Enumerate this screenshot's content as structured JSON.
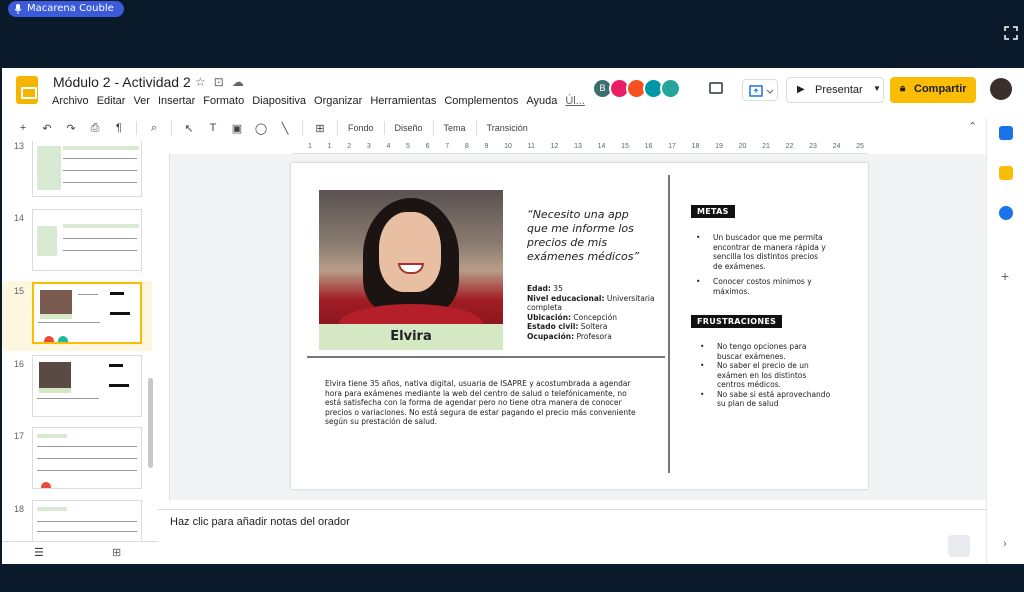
{
  "meet": {
    "user": "Macarena Couble"
  },
  "doc": {
    "title": "Módulo 2 - Actividad 2",
    "menu": [
      "Archivo",
      "Editar",
      "Ver",
      "Insertar",
      "Formato",
      "Diapositiva",
      "Organizar",
      "Herramientas",
      "Complementos",
      "Ayuda",
      "Úl..."
    ],
    "present_label": "Presentar",
    "share_label": "Compartir",
    "avatar_b": "B",
    "avatar_colors": [
      "#3c6e71",
      "#e91e63",
      "#f4511e",
      "#0097a7",
      "#26a69a"
    ]
  },
  "toolbar": {
    "fondo": "Fondo",
    "diseno": "Diseño",
    "tema": "Tema",
    "transicion": "Transición"
  },
  "ruler": [
    "1",
    "1",
    "2",
    "3",
    "4",
    "5",
    "6",
    "7",
    "8",
    "9",
    "10",
    "11",
    "12",
    "13",
    "14",
    "15",
    "16",
    "17",
    "18",
    "19",
    "20",
    "21",
    "22",
    "23",
    "24",
    "25"
  ],
  "slides": {
    "numbers": [
      "13",
      "14",
      "15",
      "16",
      "17",
      "18"
    ]
  },
  "persona": {
    "name": "Elvira",
    "quote": "“Necesito una app que me informe los precios de mis exámenes médicos”",
    "edad_label": "Edad:",
    "edad": " 35",
    "nivel_label": "Nivel educacional:",
    "nivel": " Universitaria completa",
    "ubicacion_label": "Ubicación:",
    "ubicacion": " Concepción",
    "civil_label": "Estado civil:",
    "civil": "  Soltera",
    "ocupacion_label": "Ocupación:",
    "ocupacion": " Profesora",
    "description": "Elvira tiene 35 años, nativa digital, usuaria de ISAPRE y acostumbrada a agendar hora para exámenes mediante la web del centro de salud o telefónicamente, no está satisfecha con la forma de agendar pero no tiene otra manera de conocer precios o variaciones. No está segura de estar pagando el precio más conveniente según su prestación de salud.",
    "metas_title": "METAS",
    "metas": [
      "Un buscador que me permita encontrar de manera rápida y sencilla los distintos precios de exámenes.",
      "Conocer costos mínimos y máximos."
    ],
    "frus_title": "FRUSTRACIONES",
    "frustraciones": [
      "No tengo opciones para buscar exámenes.",
      "No saber el precio de un exámen en los distintos centros médicos.",
      "No sabe si está aprovechando su plan de salud"
    ]
  },
  "notes": {
    "placeholder": "Haz clic para añadir notas del orador"
  }
}
